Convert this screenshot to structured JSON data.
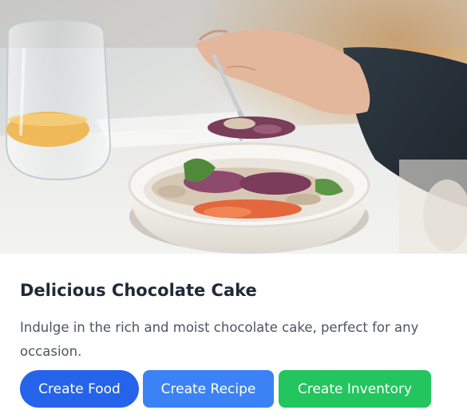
{
  "card": {
    "image_alt": "Person eating a salad from a white bowl",
    "title": "Delicious Chocolate Cake",
    "description": "Indulge in the rich and moist chocolate cake, perfect for any occasion."
  },
  "actions": {
    "create_food": "Create Food",
    "create_recipe": "Create Recipe",
    "create_inventory": "Create Inventory"
  },
  "colors": {
    "food_button": "#2563eb",
    "recipe_button": "#3b82f6",
    "inventory_button": "#22c55e",
    "title_text": "#1f2937",
    "body_text": "#4b5563"
  }
}
